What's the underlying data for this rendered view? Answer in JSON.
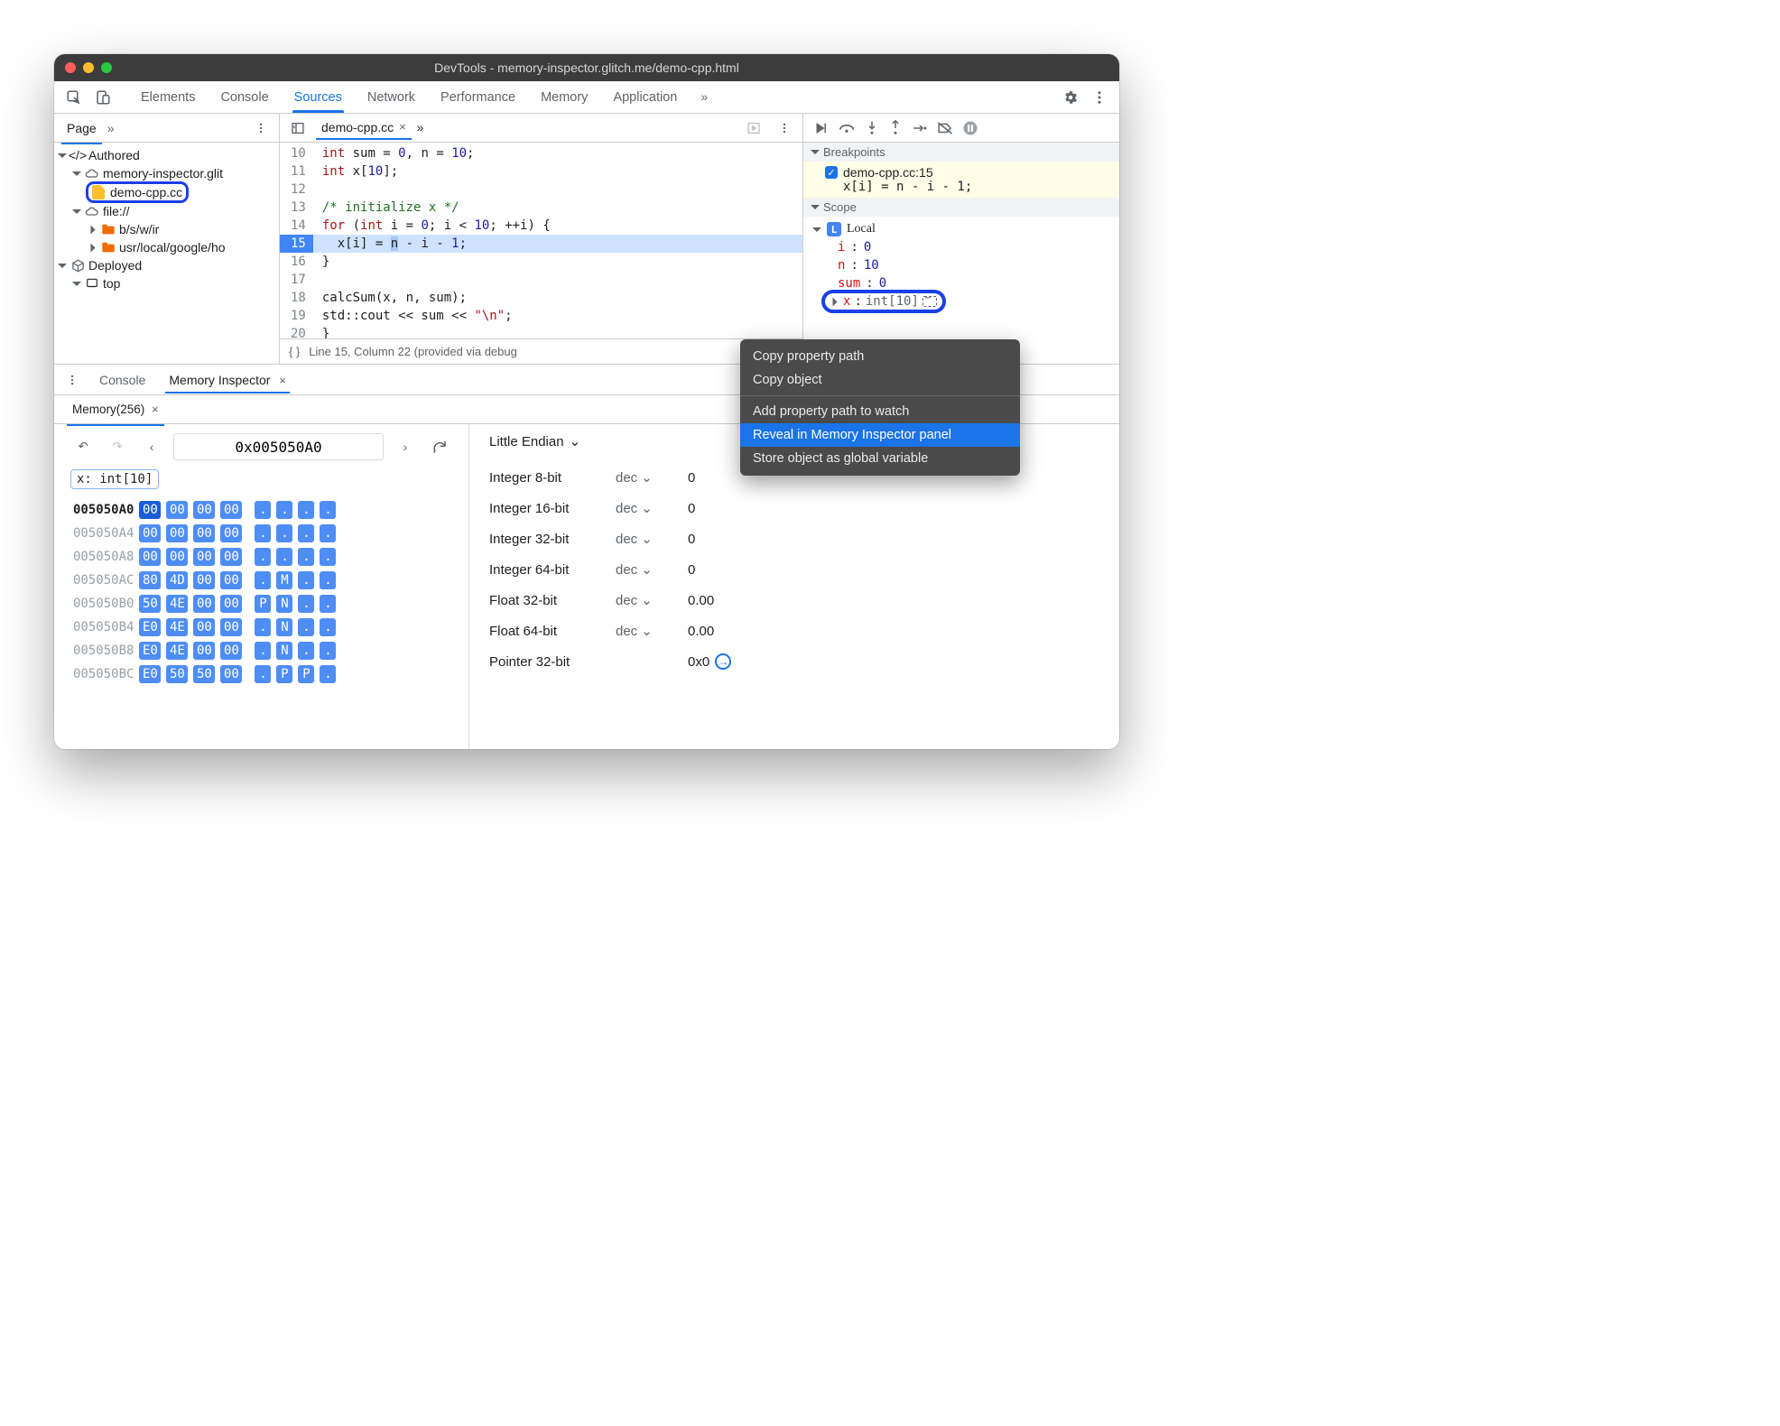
{
  "window": {
    "title": "DevTools - memory-inspector.glitch.me/demo-cpp.html"
  },
  "mainTabs": [
    "Elements",
    "Console",
    "Sources",
    "Network",
    "Performance",
    "Memory",
    "Application"
  ],
  "activeMainTab": "Sources",
  "leftPanel": {
    "pagesLabel": "Page",
    "tree": {
      "authored": "Authored",
      "origin": "memory-inspector.glit",
      "file": "demo-cpp.cc",
      "fileScheme": "file://",
      "folders": [
        "b/s/w/ir",
        "usr/local/google/ho"
      ],
      "deployed": "Deployed",
      "top": "top"
    }
  },
  "editor": {
    "tab": "demo-cpp.cc",
    "lines": {
      "10": "int sum = 0, n = 10;",
      "11": "int x[10];",
      "12": "",
      "13": "/* initialize x */",
      "14": "for (int i = 0; i < 10; ++i) {",
      "15": "  x[i] = n - i - 1;",
      "16": "}",
      "17": "",
      "18": "calcSum(x, n, sum);",
      "19": "std::cout << sum << \"\\n\";",
      "20": "}"
    },
    "status": "Line 15, Column 22  (provided via debug"
  },
  "debugger": {
    "breakpointsLabel": "Breakpoints",
    "bpFile": "demo-cpp.cc:15",
    "bpCode": "x[i] = n - i - 1;",
    "scopeLabel": "Scope",
    "localLabel": "Local",
    "vars": {
      "i": {
        "name": "i",
        "val": "0"
      },
      "n": {
        "name": "n",
        "val": "10"
      },
      "sum": {
        "name": "sum",
        "val": "0"
      },
      "x": {
        "name": "x",
        "val": "int[10]"
      }
    }
  },
  "contextMenu": {
    "items": [
      "Copy property path",
      "Copy object",
      "Add property path to watch",
      "Reveal in Memory Inspector panel",
      "Store object as global variable"
    ],
    "highlighted": 3
  },
  "drawer": {
    "tabs": [
      "Console",
      "Memory Inspector"
    ],
    "memorySub": "Memory(256)",
    "nav": {
      "address": "0x005050A0"
    },
    "chip": "x: int[10]",
    "rows": [
      {
        "addr": "005050A0",
        "bytes": [
          "00",
          "00",
          "00",
          "00"
        ],
        "ascii": [
          ".",
          ".",
          ".",
          "."
        ],
        "bold": true,
        "sel": 0
      },
      {
        "addr": "005050A4",
        "bytes": [
          "00",
          "00",
          "00",
          "00"
        ],
        "ascii": [
          ".",
          ".",
          ".",
          "."
        ]
      },
      {
        "addr": "005050A8",
        "bytes": [
          "00",
          "00",
          "00",
          "00"
        ],
        "ascii": [
          ".",
          ".",
          ".",
          "."
        ]
      },
      {
        "addr": "005050AC",
        "bytes": [
          "80",
          "4D",
          "00",
          "00"
        ],
        "ascii": [
          ".",
          "M",
          ".",
          "."
        ]
      },
      {
        "addr": "005050B0",
        "bytes": [
          "50",
          "4E",
          "00",
          "00"
        ],
        "ascii": [
          "P",
          "N",
          ".",
          "."
        ]
      },
      {
        "addr": "005050B4",
        "bytes": [
          "E0",
          "4E",
          "00",
          "00"
        ],
        "ascii": [
          ".",
          "N",
          ".",
          "."
        ]
      },
      {
        "addr": "005050B8",
        "bytes": [
          "E0",
          "4E",
          "00",
          "00"
        ],
        "ascii": [
          ".",
          "N",
          ".",
          "."
        ]
      },
      {
        "addr": "005050BC",
        "bytes": [
          "E0",
          "50",
          "50",
          "00"
        ],
        "ascii": [
          ".",
          "P",
          "P",
          "."
        ]
      }
    ],
    "endianLabel": "Little Endian",
    "valueTypes": [
      {
        "name": "Integer 8-bit",
        "fmt": "dec",
        "val": "0"
      },
      {
        "name": "Integer 16-bit",
        "fmt": "dec",
        "val": "0"
      },
      {
        "name": "Integer 32-bit",
        "fmt": "dec",
        "val": "0"
      },
      {
        "name": "Integer 64-bit",
        "fmt": "dec",
        "val": "0"
      },
      {
        "name": "Float 32-bit",
        "fmt": "dec",
        "val": "0.00"
      },
      {
        "name": "Float 64-bit",
        "fmt": "dec",
        "val": "0.00"
      },
      {
        "name": "Pointer 32-bit",
        "fmt": "",
        "val": "0x0",
        "link": true
      }
    ]
  }
}
